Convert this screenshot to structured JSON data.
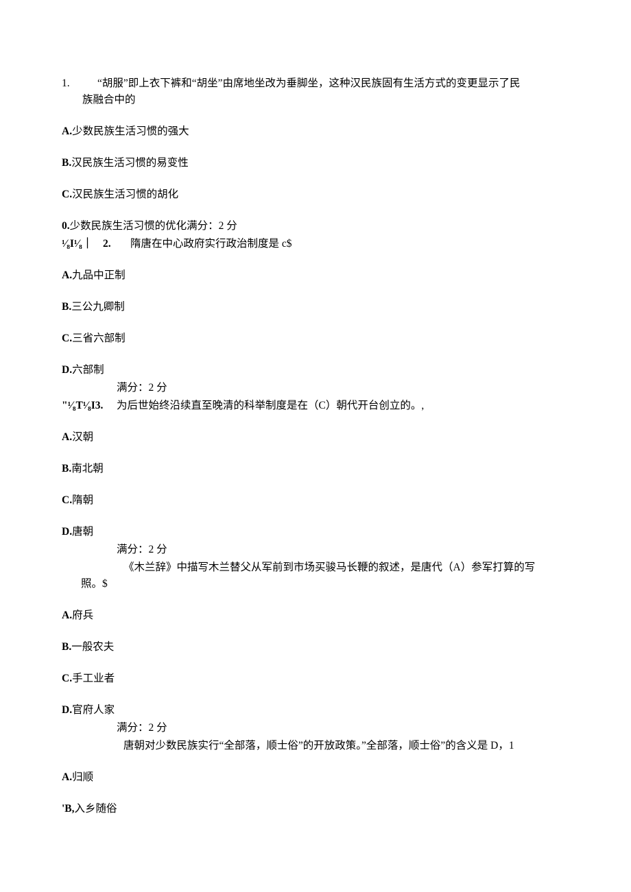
{
  "q1": {
    "number": "1.",
    "line1": "“胡服”即上衣下裤和“胡坐”由席地坐改为垂脚坐，这种汉民族固有生活方式的变更显示了民",
    "line2": "族融合中的",
    "opts": {
      "a": {
        "label": "A.",
        "text": "少数民族生活习惯的强大"
      },
      "b": {
        "label": "B.",
        "text": "汉民族生活习惯的易变性"
      },
      "c": {
        "label": "C.",
        "text": "汉民族生活习惯的胡化"
      },
      "d": {
        "label": "0.",
        "text": "少数民族生活习惯的优化满分：2 分"
      }
    }
  },
  "q2": {
    "prefix": "¹⁄₈I¹⁄₈｜",
    "number": "2.",
    "text": "隋唐在中心政府实行政治制度是 c$",
    "opts": {
      "a": {
        "label": "A.",
        "text": "九品中正制"
      },
      "b": {
        "label": "B.",
        "text": "三公九卿制"
      },
      "c": {
        "label": "C.",
        "text": "三省六部制"
      },
      "d": {
        "label": "D.",
        "text": "六部制"
      }
    },
    "score": "满分：2 分"
  },
  "q3": {
    "prefix": "\"¹⁄₈T¹⁄₈I3.",
    "text": "为后世始终沿续直至晚清的科举制度是在（C）朝代开台创立的。,",
    "opts": {
      "a": {
        "label": "A.",
        "text": "汉朝"
      },
      "b": {
        "label": "B.",
        "text": "南北朝"
      },
      "c": {
        "label": "C.",
        "text": "隋朝"
      },
      "d": {
        "label": "D.",
        "text": "唐朝"
      }
    },
    "score": "满分：2 分"
  },
  "q4": {
    "line1": "《木兰辞》中描写木兰替父从军前到市场买骏马长鞭的叙述，是唐代（A）参军打算的写",
    "line2": "照。$",
    "opts": {
      "a": {
        "label": "A.",
        "text": "府兵"
      },
      "b": {
        "label": "B.",
        "text": "一般农夫"
      },
      "c": {
        "label": "C.",
        "text": "手工业者"
      },
      "d": {
        "label": "D.",
        "text": "官府人家"
      }
    },
    "score": "满分：2 分"
  },
  "q5": {
    "text": "唐朝对少数民族实行“全部落，顺士俗”的开放政策。”全部落，顺士俗”的含义是 D，1",
    "opts": {
      "a": {
        "label": "A.",
        "text": "归顺"
      },
      "b": {
        "label": "'B,",
        "text": "入乡随俗"
      }
    }
  }
}
